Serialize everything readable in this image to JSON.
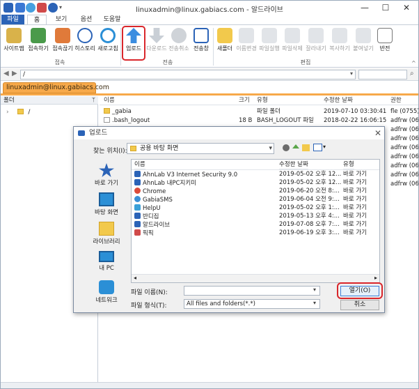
{
  "window": {
    "title": "linuxadmin@linux.gabiacs.com - 알드라이브",
    "minimize": "—",
    "maximize": "☐",
    "close": "✕"
  },
  "ribbon_tabs": [
    "파일",
    "홈",
    "보기",
    "옵션",
    "도움말"
  ],
  "ribbon": {
    "connect_group": "접속",
    "transfer_group": "전송",
    "edit_group": "편집",
    "connect_items": [
      "사이트맵",
      "접속하기",
      "접속끊기",
      "히스토리",
      "새로고침"
    ],
    "transfer_items": [
      "업로드",
      "다운로드",
      "전송취소",
      "전송창"
    ],
    "edit_items": [
      "새폴더",
      "이름변경",
      "파일실행",
      "파일삭제",
      "잘라내기",
      "복사하기",
      "붙여넣기",
      "반전"
    ]
  },
  "pathbar": {
    "path": "/"
  },
  "connection_tab": "linuxadmin@linux.gabiacs.com",
  "folder_pane": {
    "header": "폴더",
    "pin": "ᛘ",
    "root": "/"
  },
  "file_list": {
    "headers": [
      "이름",
      "크기",
      "유형",
      "수정한 날짜",
      "권한"
    ],
    "rows": [
      {
        "name": "_gabia",
        "size": "",
        "type": "파일 폴더",
        "date": "2019-07-10 03:30:41",
        "perm": "fle (0755)"
      },
      {
        "name": ".bash_logout",
        "size": "18 B",
        "type": "BASH_LOGOUT 파일",
        "date": "2018-02-22 16:06:15",
        "perm": "adfrw (06-"
      }
    ],
    "perm_extra": [
      "adfrw (06-",
      "adfrw (06-",
      "adfrw (06-",
      "adfrw (06-",
      "adfrw (06-",
      "adfrw (06-",
      "adfrw (06-"
    ]
  },
  "dialog": {
    "title": "업로드",
    "look_in_label": "찾는 위치(I):",
    "look_in_value": "공용 바탕 화면",
    "places": [
      "바로 가기",
      "바탕 화면",
      "라이브러리",
      "내 PC",
      "네트워크"
    ],
    "headers": [
      "이름",
      "수정한 날짜",
      "유형"
    ],
    "rows": [
      {
        "name": "AhnLab V3 Internet Security 9.0",
        "date": "2019-05-02 오후 12...",
        "type": "바로 가기"
      },
      {
        "name": "AhnLab 내PC지키미",
        "date": "2019-05-02 오후 12...",
        "type": "바로 가기"
      },
      {
        "name": "Chrome",
        "date": "2019-06-20 오전 8:...",
        "type": "바로 가기"
      },
      {
        "name": "GabiaSMS",
        "date": "2019-06-04 오전 9:...",
        "type": "바로 가기"
      },
      {
        "name": "HelpU",
        "date": "2019-05-02 오후 1:...",
        "type": "바로 가기"
      },
      {
        "name": "반디집",
        "date": "2019-05-13 오후 4:...",
        "type": "바로 가기"
      },
      {
        "name": "알드라이브",
        "date": "2019-07-08 오후 7:...",
        "type": "바로 가기"
      },
      {
        "name": "픽픽",
        "date": "2019-06-19 오후 3:...",
        "type": "바로 가기"
      }
    ],
    "file_name_label": "파일 이름(N):",
    "file_name_value": "",
    "file_type_label": "파일 형식(T):",
    "file_type_value": "All files and folders(*.*)",
    "open_button": "열기(O)",
    "cancel_button": "취소"
  },
  "colors": {
    "accent": "#2b63b7",
    "connection_tab": "#f7a94a",
    "highlight": "#d9262b"
  }
}
